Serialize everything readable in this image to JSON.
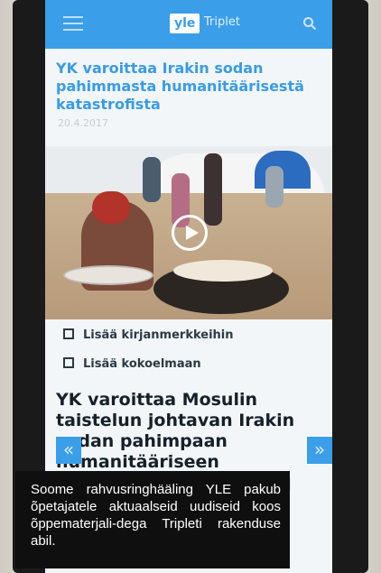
{
  "app": {
    "logo": "yle",
    "brand": "Triplet"
  },
  "article": {
    "headline": "YK varoittaa Irakin sodan pahimmasta humanitäärisestä katastrofista",
    "date": "20.4.2017"
  },
  "actions": {
    "bookmark": "Lisää kirjanmerkkeihin",
    "collection": "Lisää kokoelmaan"
  },
  "next_article": {
    "headline": "YK varoittaa Mosulin taistelun johtavan Irakin sodan pahimpaan humanitääriseen"
  },
  "nav": {
    "prev": "«",
    "next": "»"
  },
  "caption": "Soome rahvusringhääling YLE pakub õpetajatele aktuaalseid uudiseid koos õppematerjali-dega Tripleti rakenduse abil."
}
